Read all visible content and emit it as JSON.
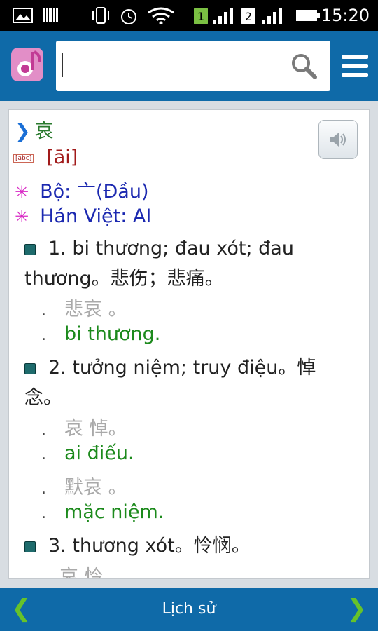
{
  "status": {
    "time": "15:20",
    "sim1": "1",
    "sim2": "2"
  },
  "search": {
    "value": "",
    "placeholder": ""
  },
  "entry": {
    "character": "哀",
    "pinyin": "[āi]",
    "radical": "Bộ: 亠(Đầu)",
    "han_viet": "Hán Việt: AI",
    "definitions": [
      {
        "text": "1. bi thương; đau xót; đau thương。悲伤；悲痛。",
        "examples": [
          {
            "zh": "悲哀 。",
            "vi": "bi thương."
          }
        ]
      },
      {
        "text": "2. tưởng niệm; truy điệu。悼念。",
        "examples": [
          {
            "zh": "哀 悼。",
            "vi": "ai điếu."
          },
          {
            "zh": "默哀 。",
            "vi": "mặc niệm."
          }
        ]
      },
      {
        "text": "3. thương xót。怜悯。",
        "examples": [
          {
            "zh": "哀 怜",
            "vi": ""
          }
        ]
      }
    ]
  },
  "bottom": {
    "history_label": "Lịch sử",
    "prev": "❮",
    "next": "❯"
  },
  "colors": {
    "header": "#0f6aa8",
    "nav_arrow": "#66c22a"
  }
}
